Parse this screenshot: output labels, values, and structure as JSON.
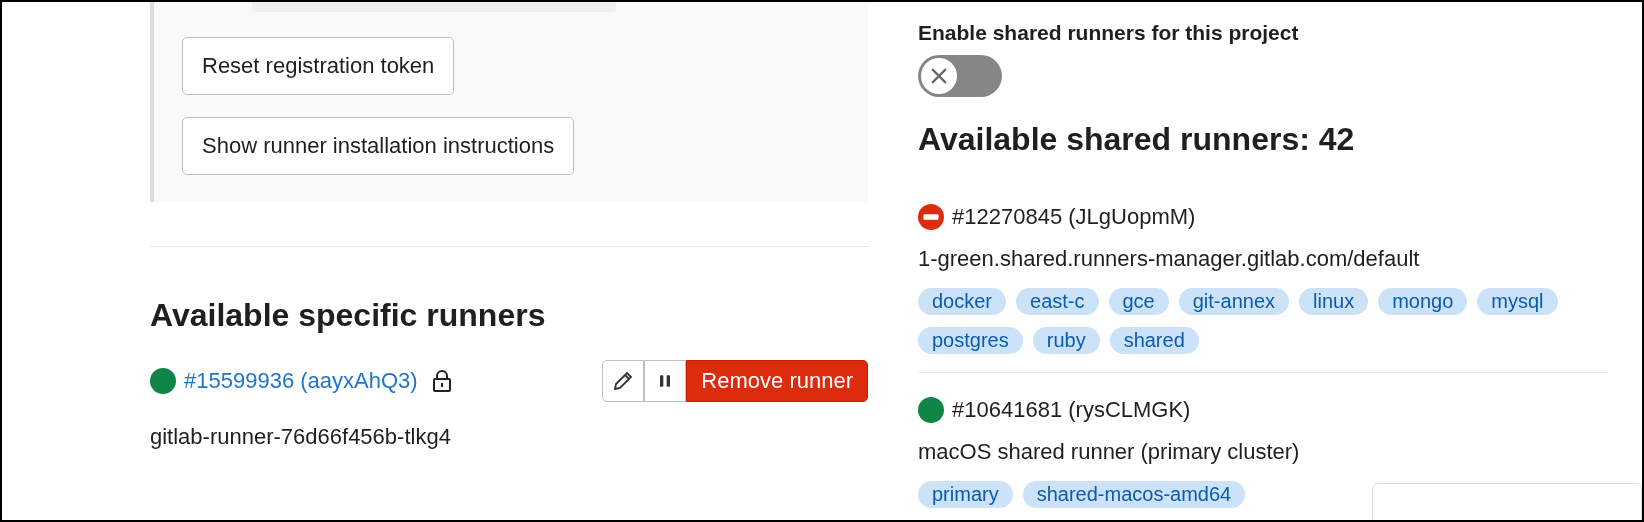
{
  "registration": {
    "buttons": [
      "Reset registration token",
      "Show runner installation instructions"
    ]
  },
  "specific_runners": {
    "title": "Available specific runners",
    "runners": [
      {
        "kind": "online",
        "name": "#15599936 (aayxAhQ3)",
        "locked": true,
        "description": "gitlab-runner-76d66f456b-tlkg4",
        "actions": {
          "remove": "Remove runner"
        }
      }
    ]
  },
  "shared_runners": {
    "toggle_label": "Enable shared runners for this project",
    "enabled": false,
    "title": "Available shared runners: 42",
    "runners": [
      {
        "kind": "paused",
        "name": "#12270845 (JLgUopmM)",
        "description": "1-green.shared.runners-manager.gitlab.com/default",
        "tags": [
          "docker",
          "east-c",
          "gce",
          "git-annex",
          "linux",
          "mongo",
          "mysql",
          "postgres",
          "ruby",
          "shared"
        ]
      },
      {
        "kind": "online",
        "name": "#10641681 (rysCLMGK)",
        "description": "macOS shared runner (primary cluster)",
        "tags": [
          "primary",
          "shared-macos-amd64"
        ]
      }
    ]
  }
}
